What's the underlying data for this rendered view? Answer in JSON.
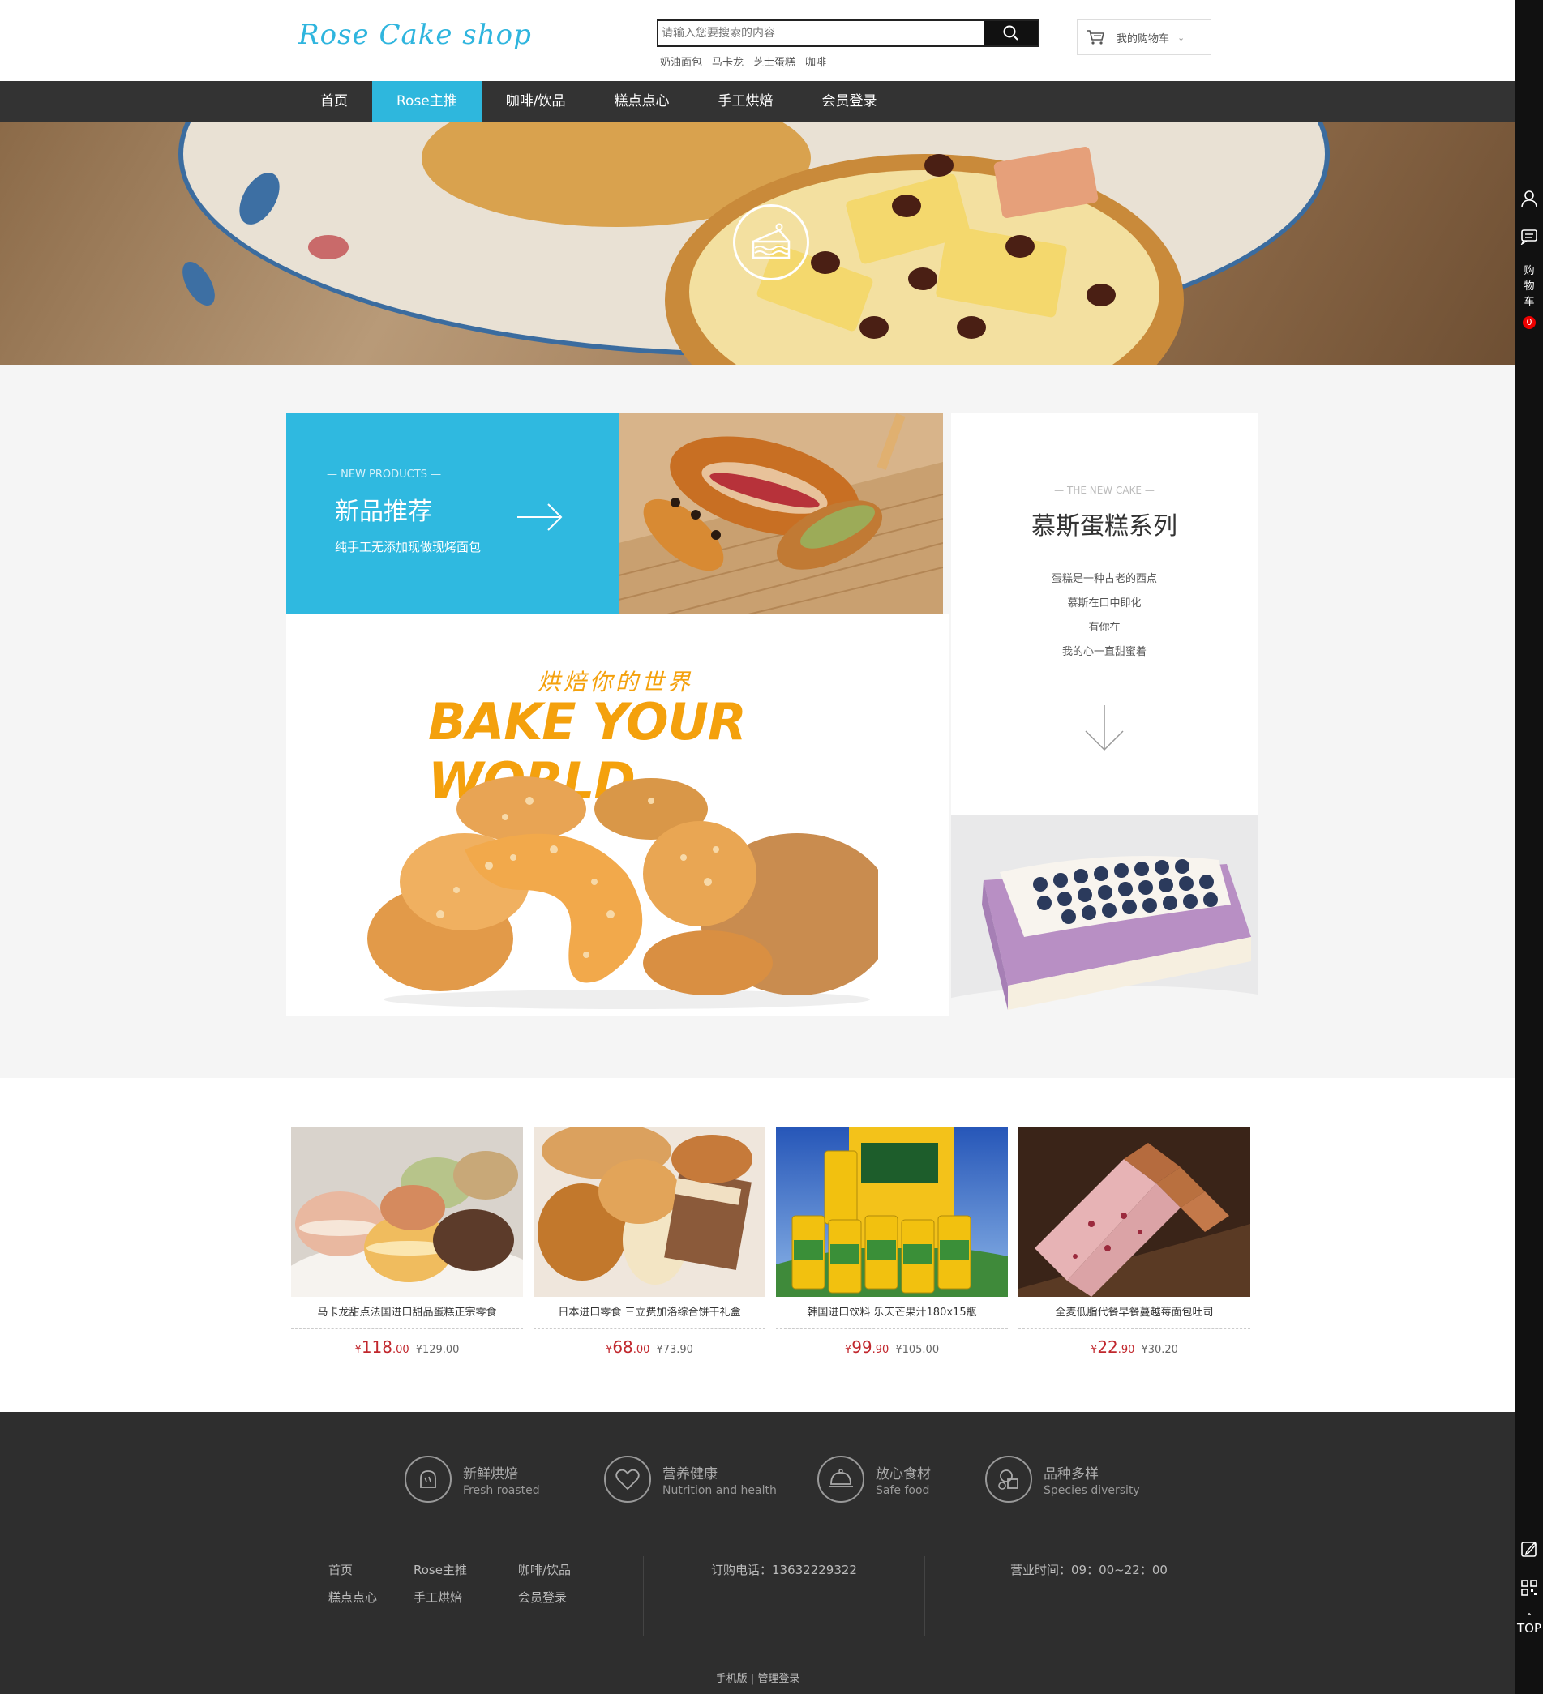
{
  "header": {
    "logo_text": "Rose Cake shop",
    "search_placeholder": "请输入您要搜索的内容",
    "search_icon": "search-icon",
    "hot_keywords": [
      "奶油面包",
      "马卡龙",
      "芝士蛋糕",
      "咖啡"
    ],
    "cart_label": "我的购物车",
    "cart_icon": "cart-icon"
  },
  "nav": {
    "items": [
      {
        "label": "首页"
      },
      {
        "label": "Rose主推"
      },
      {
        "label": "咖啡/饮品"
      },
      {
        "label": "糕点点心"
      },
      {
        "label": "手工烘焙"
      },
      {
        "label": "会员登录"
      }
    ],
    "active_index": 1,
    "active_color": "#2eb7dd"
  },
  "banner": {
    "badge_icon": "cake-slice-icon"
  },
  "new_products": {
    "en": "— NEW PRODUCTS —",
    "title": "新品推荐",
    "desc": "纯手工无添加现做现烤面包",
    "arrow_icon": "arrow-right-icon"
  },
  "bake": {
    "cn": "烘焙你的世界",
    "en": "BAKE YOUR WORLD"
  },
  "mousse": {
    "en": "— THE NEW CAKE —",
    "title": "慕斯蛋糕系列",
    "lines": [
      "蛋糕是一种古老的西点",
      "慕斯在口中即化",
      "有你在",
      "我的心一直甜蜜着"
    ],
    "arrow_icon": "arrow-down-icon"
  },
  "products": [
    {
      "name": "马卡龙甜点法国进口甜品蛋糕正宗零食",
      "currency": "¥",
      "price_int": "118",
      "price_dec": ".00",
      "old_price": "¥129.00"
    },
    {
      "name": "日本进口零食 三立费加洛综合饼干礼盒",
      "currency": "¥",
      "price_int": "68",
      "price_dec": ".00",
      "old_price": "¥73.90"
    },
    {
      "name": "韩国进口饮料 乐天芒果汁180x15瓶",
      "currency": "¥",
      "price_int": "99",
      "price_dec": ".90",
      "old_price": "¥105.00"
    },
    {
      "name": "全麦低脂代餐早餐蔓越莓面包吐司",
      "currency": "¥",
      "price_int": "22",
      "price_dec": ".90",
      "old_price": "¥30.20"
    }
  ],
  "footer": {
    "features": [
      {
        "cn": "新鲜烘焙",
        "en": "Fresh roasted",
        "icon": "bread-icon"
      },
      {
        "cn": "营养健康",
        "en": "Nutrition and health",
        "icon": "heart-icon"
      },
      {
        "cn": "放心食材",
        "en": "Safe food",
        "icon": "dish-icon"
      },
      {
        "cn": "品种多样",
        "en": "Species diversity",
        "icon": "variety-icon"
      }
    ],
    "links": [
      "首页",
      "Rose主推",
      "咖啡/饮品",
      "糕点点心",
      "手工烘焙",
      "会员登录"
    ],
    "tel": "订购电话：13632229322",
    "hours": "营业时间：09：00~22：00",
    "mobile": "手机版",
    "divider": "|",
    "admin": "管理登录"
  },
  "sidebar": {
    "user_icon": "user-icon",
    "message_icon": "message-icon",
    "cart_text": [
      "购",
      "物",
      "车"
    ],
    "cart_count": "0",
    "edit_icon": "edit-icon",
    "qr_icon": "qr-code-icon",
    "top_label": "TOP"
  }
}
